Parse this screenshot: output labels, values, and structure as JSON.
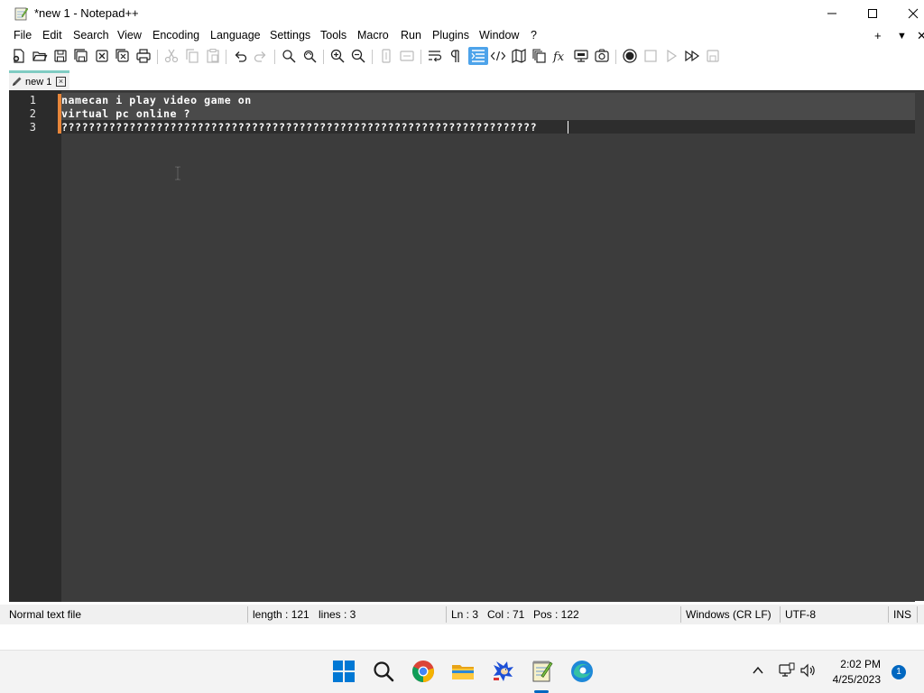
{
  "window": {
    "title": "*new 1 - Notepad++"
  },
  "menu": {
    "items": [
      "File",
      "Edit",
      "Search",
      "View",
      "Encoding",
      "Language",
      "Settings",
      "Tools",
      "Macro",
      "Run",
      "Plugins",
      "Window",
      "?"
    ],
    "right": [
      "+",
      "▼",
      "✕"
    ]
  },
  "toolbar": {
    "icons": [
      "new-file-icon",
      "open-file-icon",
      "save-icon",
      "save-all-icon",
      "close-icon",
      "close-all-icon",
      "print-icon",
      "cut-icon",
      "copy-icon",
      "paste-icon",
      "undo-icon",
      "redo-icon",
      "find-icon",
      "replace-icon",
      "zoom-in-icon",
      "zoom-out-icon",
      "sync-vertical-icon",
      "sync-horizontal-icon",
      "word-wrap-icon",
      "show-all-chars-icon",
      "indent-guide-icon",
      "xml-tag-icon",
      "document-map-icon",
      "document-list-icon",
      "function-list-icon",
      "folder-as-workspace-icon",
      "monitoring-icon",
      "record-macro-icon",
      "stop-record-icon",
      "play-macro-icon",
      "run-macro-multiple-icon",
      "save-macro-icon"
    ],
    "active_icon": "indent-guide-icon"
  },
  "tab": {
    "label": "new 1"
  },
  "editor": {
    "line_numbers": [
      "1",
      "2",
      "3"
    ],
    "lines": [
      "namecan i play video game on",
      "virtual pc online ?",
      "??????????????????????????????????????????????????????????????????????"
    ]
  },
  "status": {
    "file_type": "Normal text file",
    "length": "length : 121",
    "lines": "lines : 3",
    "ln": "Ln : 3",
    "col": "Col : 71",
    "pos": "Pos : 122",
    "eol": "Windows (CR LF)",
    "encoding": "UTF-8",
    "mode": "INS"
  },
  "taskbar": {
    "apps": [
      "windows-start-icon",
      "search-icon",
      "chrome-icon",
      "file-explorer-icon",
      "sonic-game-icon",
      "notepad-plus-plus-icon",
      "edge-icon"
    ],
    "time": "2:02 PM",
    "date": "4/25/2023",
    "notification_count": "1"
  }
}
